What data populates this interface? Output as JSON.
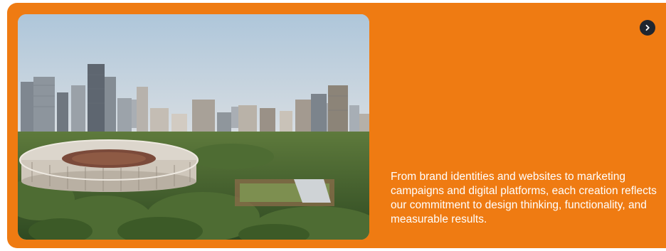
{
  "card": {
    "description": "From brand identities and websites to marketing campaigns and digital platforms, each creation reflects our commitment to design thinking, functionality, and measurable results."
  },
  "icons": {
    "next": "chevron-right-icon"
  },
  "colors": {
    "card_background": "#ef7b12",
    "button_background": "#1f2630",
    "text": "#ffffff"
  }
}
